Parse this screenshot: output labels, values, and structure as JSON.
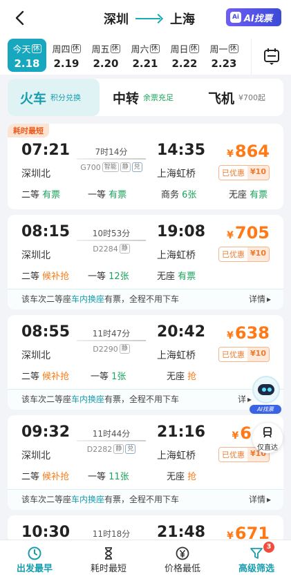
{
  "header": {
    "from": "深圳",
    "to": "上海",
    "ai_label": "AI找票",
    "ai_icon": "Ai"
  },
  "dates": [
    {
      "weekday": "今天",
      "rest": "休",
      "date": "2.18",
      "active": true
    },
    {
      "weekday": "周四",
      "rest": "休",
      "date": "2.19"
    },
    {
      "weekday": "周五",
      "rest": "休",
      "date": "2.20"
    },
    {
      "weekday": "周六",
      "rest": "休",
      "date": "2.21"
    },
    {
      "weekday": "周日",
      "rest": "休",
      "date": "2.22"
    },
    {
      "weekday": "周一",
      "rest": "休",
      "date": "2.23"
    }
  ],
  "modes": [
    {
      "name": "火车",
      "sub": "积分兑换"
    },
    {
      "name": "中转",
      "sub": "余票充足"
    },
    {
      "name": "飞机",
      "sub": "¥700起"
    }
  ],
  "trains": [
    {
      "tag": "耗时最短",
      "depart": "07:21",
      "from": "深圳北",
      "duration": "7时14分",
      "number": "G700",
      "features": [
        "智能",
        "静",
        "兑"
      ],
      "arrive": "14:35",
      "to": "上海虹桥",
      "yen": "¥",
      "price": "864",
      "disc_label": "已优惠",
      "disc_value": "¥10",
      "seats": [
        {
          "cls": "二等",
          "status": "有票"
        },
        {
          "cls": "一等",
          "status": "有票"
        },
        {
          "cls": "商务",
          "status": "6张"
        },
        {
          "cls": "无座",
          "status": "有票"
        }
      ]
    },
    {
      "depart": "08:15",
      "from": "深圳北",
      "duration": "10时53分",
      "number": "D2284",
      "features": [
        "静"
      ],
      "arrive": "19:08",
      "to": "上海虹桥",
      "yen": "¥",
      "price": "705",
      "disc_label": "已优惠",
      "disc_value": "¥10",
      "seats": [
        {
          "cls": "二等",
          "status": "候补抢"
        },
        {
          "cls": "一等",
          "status": "12张"
        },
        {
          "cls": "无座",
          "status": "有票"
        }
      ],
      "notice": {
        "pre": "该车次二等座",
        "hl": "车内换座",
        "post": "有票，全程不用下车",
        "more": "详情"
      }
    },
    {
      "depart": "08:55",
      "from": "深圳北",
      "duration": "11时47分",
      "number": "D2290",
      "features": [
        "静"
      ],
      "arrive": "20:42",
      "to": "上海虹桥",
      "yen": "¥",
      "price": "638",
      "disc_label": "已优惠",
      "disc_value": "¥10",
      "seats": [
        {
          "cls": "二等",
          "status": "候补抢"
        },
        {
          "cls": "一等",
          "status": "1张"
        },
        {
          "cls": "无座",
          "status": "抢"
        }
      ],
      "notice": {
        "pre": "该车次二等座",
        "hl": "车内换座",
        "post": "有票，全程不用下车",
        "more": "详"
      }
    },
    {
      "depart": "09:32",
      "from": "深圳北",
      "duration": "11时44分",
      "number": "D2282",
      "features": [
        "静",
        "兑"
      ],
      "arrive": "21:16",
      "to": "上海虹桥",
      "yen": "¥",
      "price": "6",
      "disc_label": "已优惠",
      "disc_value": "¥10",
      "seats": [
        {
          "cls": "二等",
          "status": "候补抢"
        },
        {
          "cls": "一等",
          "status": "11张"
        },
        {
          "cls": "无座",
          "status": "抢"
        }
      ],
      "notice": {
        "pre": "该车次二等座",
        "hl": "车内换座",
        "post": "有票，全程不用下车",
        "more": "详情"
      }
    },
    {
      "depart": "10:30",
      "duration": "11时18分",
      "arrive": "21:48",
      "yen": "¥",
      "price": "671"
    }
  ],
  "floating": {
    "ai_chip": "AI找票",
    "direct_label": "仅直达"
  },
  "bottom": [
    {
      "label": "出发最早",
      "icon": "clock-icon",
      "active": true
    },
    {
      "label": "耗时最短",
      "icon": "hourglass-icon"
    },
    {
      "label": "价格最低",
      "icon": "yen-icon"
    },
    {
      "label": "高级筛选",
      "icon": "filter-icon",
      "badge": "3"
    }
  ],
  "colors": {
    "accent": "#179dae",
    "green": "#19a55b",
    "orange": "#ff7a16"
  }
}
